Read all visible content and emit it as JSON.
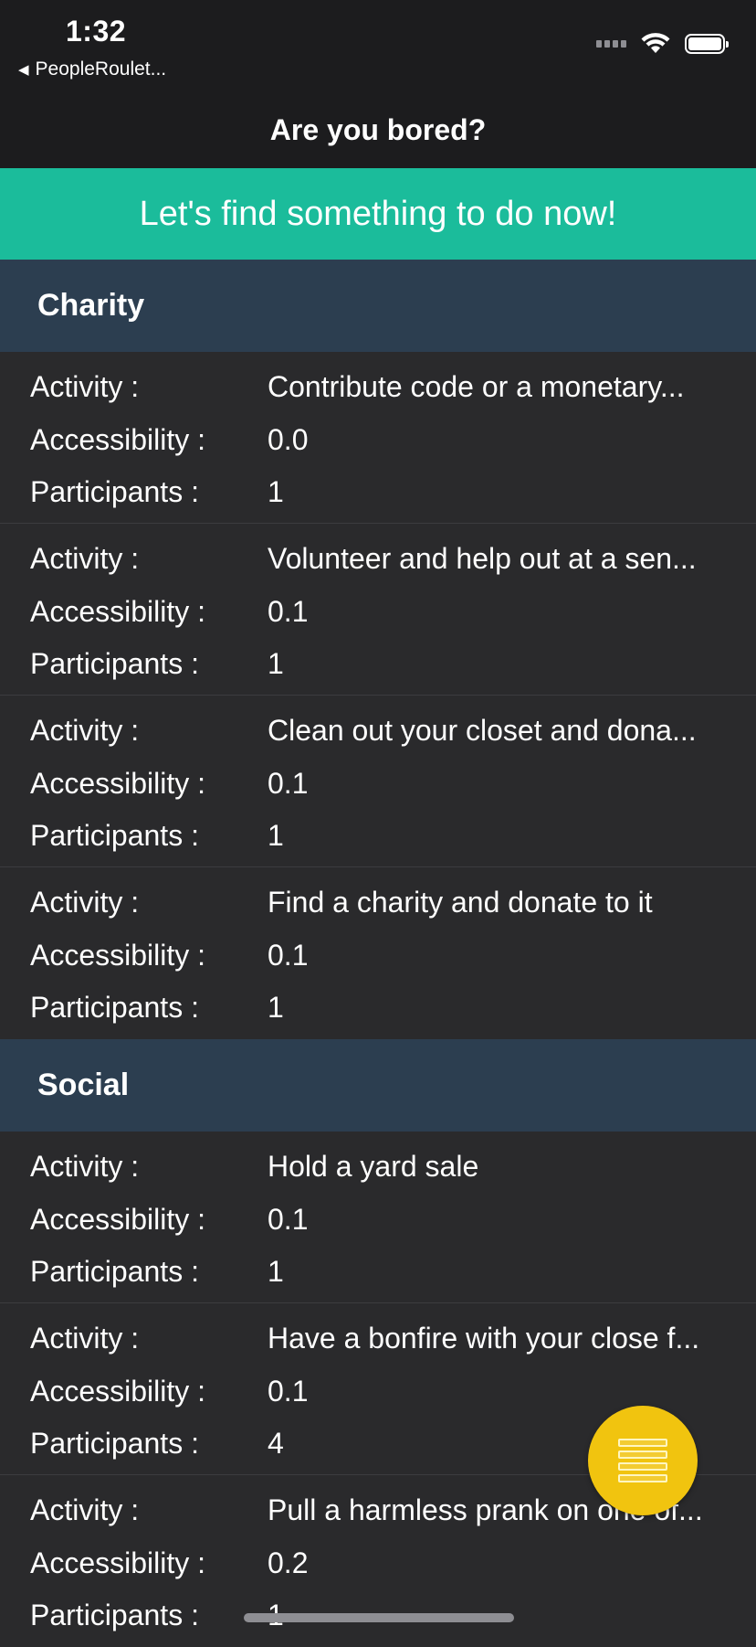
{
  "status_bar": {
    "time": "1:32",
    "back_app": "PeopleRoulet...",
    "icons": [
      "cellular-signal-icon",
      "wifi-icon",
      "battery-icon"
    ]
  },
  "nav": {
    "title": "Are you bored?"
  },
  "banner": {
    "text": "Let's find something to do now!"
  },
  "labels": {
    "activity": "Activity :",
    "accessibility": "Accessibility :",
    "participants": "Participants :"
  },
  "sections": [
    {
      "title": "Charity",
      "items": [
        {
          "activity": "Contribute code or a monetary...",
          "accessibility": "0.0",
          "participants": "1"
        },
        {
          "activity": "Volunteer and help out at a sen...",
          "accessibility": "0.1",
          "participants": "1"
        },
        {
          "activity": "Clean out your closet and dona...",
          "accessibility": "0.1",
          "participants": "1"
        },
        {
          "activity": "Find a charity and donate to it",
          "accessibility": "0.1",
          "participants": "1"
        }
      ]
    },
    {
      "title": "Social",
      "items": [
        {
          "activity": "Hold a yard sale",
          "accessibility": "0.1",
          "participants": "1"
        },
        {
          "activity": "Have a bonfire with your close f...",
          "accessibility": "0.1",
          "participants": "4"
        },
        {
          "activity": "Pull a harmless prank on one of...",
          "accessibility": "0.2",
          "participants": "1"
        }
      ]
    }
  ],
  "fab": {
    "icon": "list-icon"
  },
  "colors": {
    "banner": "#1bbc9b",
    "section_header": "#2c3e50",
    "fab": "#f1c40f",
    "background": "#2a2a2c"
  }
}
